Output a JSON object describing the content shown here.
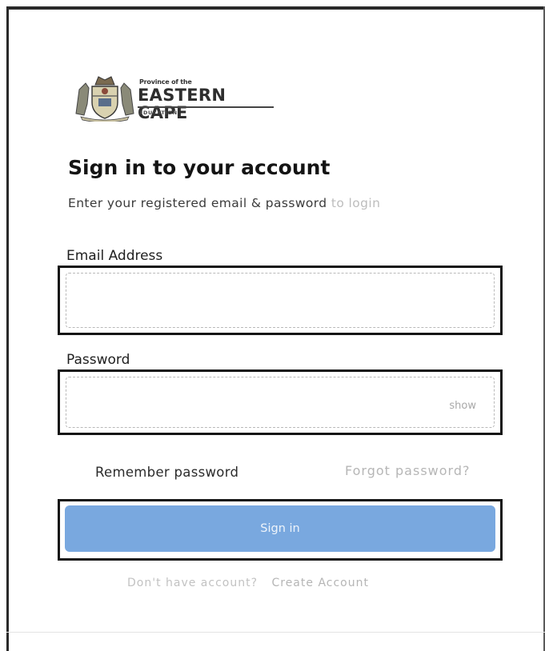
{
  "brand": {
    "province_line": "Province of the",
    "name": "EASTERN CAPE",
    "department": "EDUCATION"
  },
  "form": {
    "title": "Sign in to your account",
    "subtitle_main": "Enter your registered email & password",
    "subtitle_faint": "to login",
    "email_label": "Email Address",
    "email_value": "",
    "password_label": "Password",
    "password_value": "",
    "show_label": "show",
    "remember_label": "Remember password",
    "forgot_label": "Forgot password?",
    "submit_label": "Sign in"
  },
  "footer": {
    "prompt": "Don't have account?",
    "create_label": "Create Account"
  },
  "colors": {
    "primary_button": "#79a8df",
    "muted_text": "#b6b6b6"
  },
  "icons": {
    "crest": "provincial-coat-of-arms-icon"
  }
}
